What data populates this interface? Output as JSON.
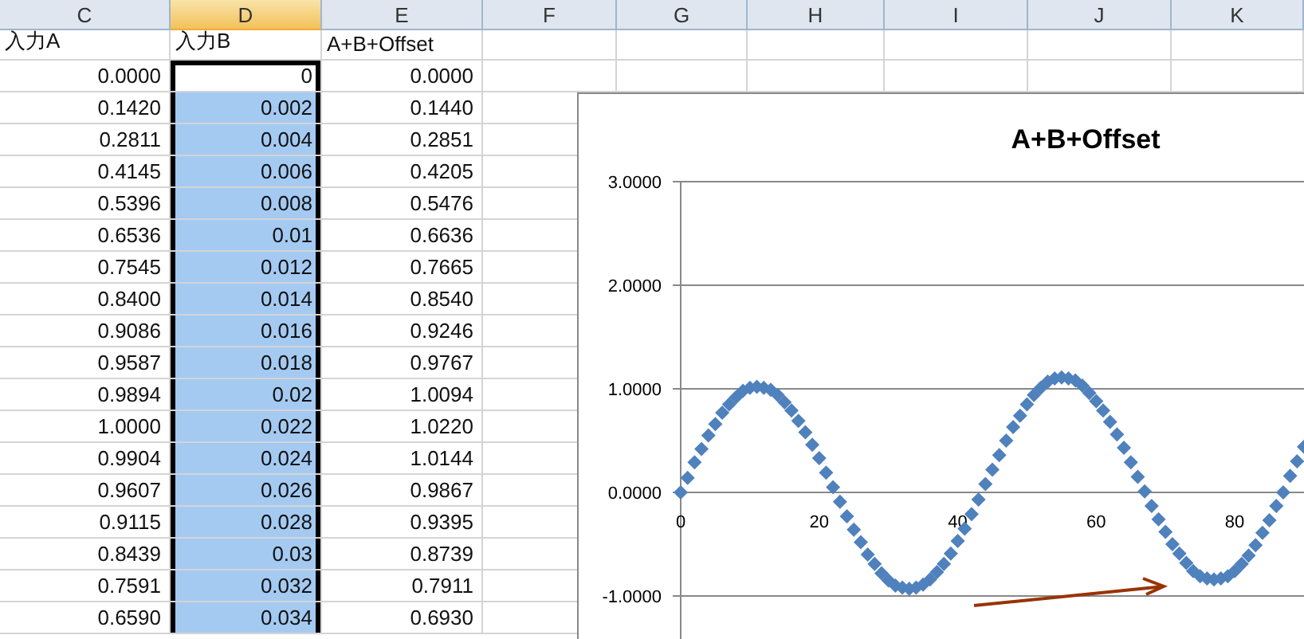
{
  "column_headers": [
    {
      "label": "C",
      "selected": false
    },
    {
      "label": "D",
      "selected": true
    },
    {
      "label": "E",
      "selected": false
    },
    {
      "label": "F",
      "selected": false
    },
    {
      "label": "G",
      "selected": false
    },
    {
      "label": "H",
      "selected": false
    },
    {
      "label": "I",
      "selected": false
    },
    {
      "label": "J",
      "selected": false
    },
    {
      "label": "K",
      "selected": false
    }
  ],
  "header_row": [
    "入力A",
    "入力B",
    "A+B+Offset"
  ],
  "rows": [
    {
      "a": "0.0000",
      "b": {
        "text": "0",
        "selected": true,
        "active": true
      },
      "e": "0.0000"
    },
    {
      "a": "0.1420",
      "b": {
        "text": "0.002",
        "selected": true,
        "active": false
      },
      "e": "0.1440"
    },
    {
      "a": "0.2811",
      "b": {
        "text": "0.004",
        "selected": true,
        "active": false
      },
      "e": "0.2851"
    },
    {
      "a": "0.4145",
      "b": {
        "text": "0.006",
        "selected": true,
        "active": false
      },
      "e": "0.4205"
    },
    {
      "a": "0.5396",
      "b": {
        "text": "0.008",
        "selected": true,
        "active": false
      },
      "e": "0.5476"
    },
    {
      "a": "0.6536",
      "b": {
        "text": "0.01",
        "selected": true,
        "active": false
      },
      "e": "0.6636"
    },
    {
      "a": "0.7545",
      "b": {
        "text": "0.012",
        "selected": true,
        "active": false
      },
      "e": "0.7665"
    },
    {
      "a": "0.8400",
      "b": {
        "text": "0.014",
        "selected": true,
        "active": false
      },
      "e": "0.8540"
    },
    {
      "a": "0.9086",
      "b": {
        "text": "0.016",
        "selected": true,
        "active": false
      },
      "e": "0.9246"
    },
    {
      "a": "0.9587",
      "b": {
        "text": "0.018",
        "selected": true,
        "active": false
      },
      "e": "0.9767"
    },
    {
      "a": "0.9894",
      "b": {
        "text": "0.02",
        "selected": true,
        "active": false
      },
      "e": "1.0094"
    },
    {
      "a": "1.0000",
      "b": {
        "text": "0.022",
        "selected": true,
        "active": false
      },
      "e": "1.0220"
    },
    {
      "a": "0.9904",
      "b": {
        "text": "0.024",
        "selected": true,
        "active": false
      },
      "e": "1.0144"
    },
    {
      "a": "0.9607",
      "b": {
        "text": "0.026",
        "selected": true,
        "active": false
      },
      "e": "0.9867"
    },
    {
      "a": "0.9115",
      "b": {
        "text": "0.028",
        "selected": true,
        "active": false
      },
      "e": "0.9395"
    },
    {
      "a": "0.8439",
      "b": {
        "text": "0.03",
        "selected": true,
        "active": false
      },
      "e": "0.8739"
    },
    {
      "a": "0.7591",
      "b": {
        "text": "0.032",
        "selected": true,
        "active": false
      },
      "e": "0.7911"
    },
    {
      "a": "0.6590",
      "b": {
        "text": "0.034",
        "selected": true,
        "active": false
      },
      "e": "0.6930"
    }
  ],
  "chart": {
    "chart_data": {
      "type": "scatter",
      "title": "A+B+Offset",
      "x": [
        0,
        1,
        2,
        3,
        4,
        5,
        6,
        7,
        8,
        9,
        10,
        11,
        12,
        13,
        14,
        15,
        16,
        17,
        18,
        19,
        20,
        21,
        22,
        23,
        24,
        25,
        26,
        27,
        28,
        29,
        30,
        31,
        32,
        33,
        34,
        35,
        36,
        37,
        38,
        39,
        40,
        41,
        42,
        43,
        44,
        45,
        46,
        47,
        48,
        49,
        50,
        51,
        52,
        53,
        54,
        55,
        56,
        57,
        58,
        59,
        60,
        61,
        62,
        63,
        64,
        65,
        66,
        67,
        68,
        69,
        70,
        71,
        72,
        73,
        74,
        75,
        76,
        77,
        78,
        79,
        80,
        81,
        82,
        83,
        84,
        85,
        86,
        87,
        88,
        89,
        90
      ],
      "series": [
        {
          "color": "#4f81bd",
          "values": [
            0,
            0.14,
            0.29,
            0.42,
            0.55,
            0.66,
            0.77,
            0.85,
            0.92,
            0.98,
            1.01,
            1.02,
            1.01,
            0.99,
            0.94,
            0.87,
            0.79,
            0.69,
            0.58,
            0.46,
            0.33,
            0.19,
            0.05,
            -0.09,
            -0.23,
            -0.36,
            -0.48,
            -0.6,
            -0.69,
            -0.78,
            -0.85,
            -0.9,
            -0.92,
            -0.93,
            -0.92,
            -0.89,
            -0.84,
            -0.77,
            -0.69,
            -0.59,
            -0.47,
            -0.35,
            -0.21,
            -0.07,
            0.08,
            0.22,
            0.36,
            0.5,
            0.63,
            0.74,
            0.85,
            0.94,
            1.01,
            1.07,
            1.1,
            1.11,
            1.1,
            1.08,
            1.03,
            0.96,
            0.88,
            0.79,
            0.68,
            0.56,
            0.43,
            0.29,
            0.15,
            0.01,
            -0.13,
            -0.26,
            -0.38,
            -0.5,
            -0.59,
            -0.68,
            -0.76,
            -0.81,
            -0.83,
            -0.84,
            -0.83,
            -0.81,
            -0.76,
            -0.69,
            -0.61,
            -0.51,
            -0.39,
            -0.27,
            -0.13,
            0,
            0.16,
            0.3,
            0.44
          ]
        }
      ],
      "xlim": [
        0,
        90
      ],
      "ylim": [
        -1.5,
        3
      ],
      "grid": true,
      "xticks": [
        0,
        20,
        40,
        60,
        80
      ],
      "yticks": [
        {
          "value": 3,
          "label": "3.0000"
        },
        {
          "value": 2,
          "label": "2.0000"
        },
        {
          "value": 1,
          "label": "1.0000"
        },
        {
          "value": 0,
          "label": "0.0000"
        },
        {
          "value": -1,
          "label": "-1.0000"
        }
      ]
    }
  }
}
